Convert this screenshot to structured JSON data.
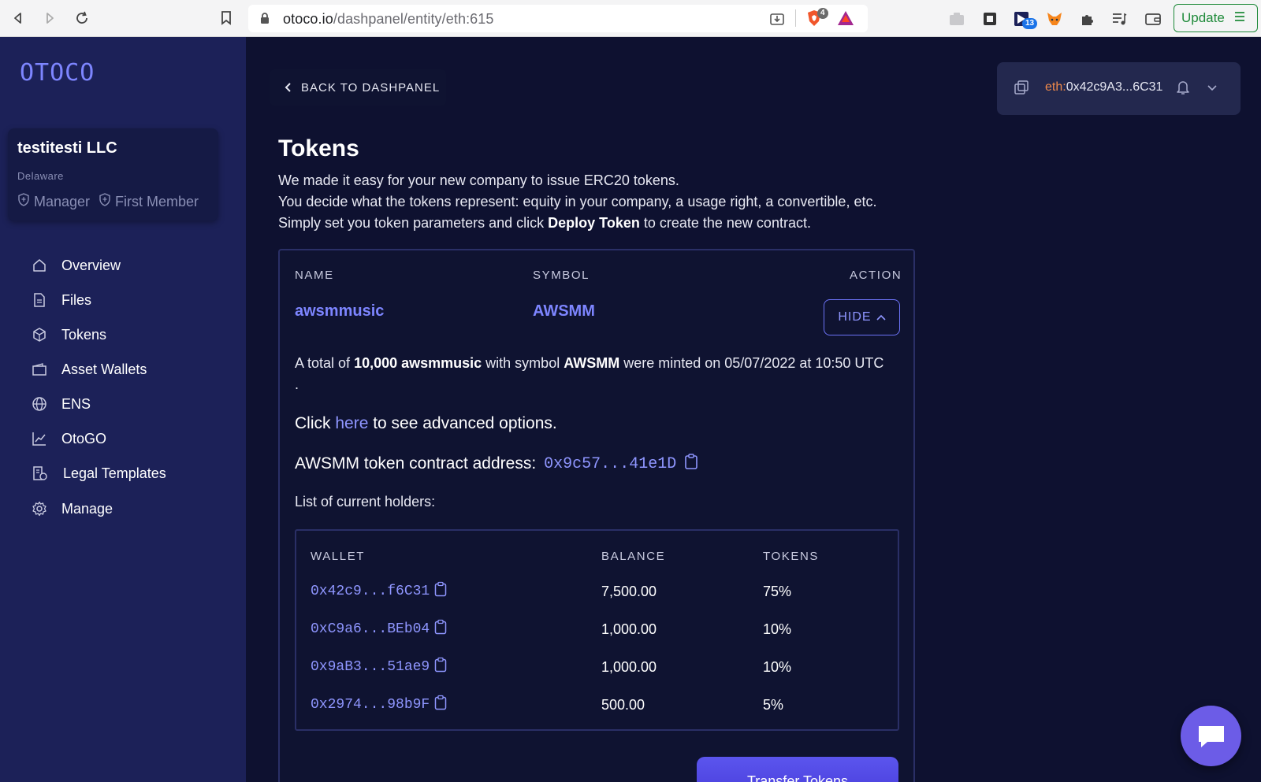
{
  "browser": {
    "url_host": "otoco.io",
    "url_path": "/dashpanel/entity/eth:615",
    "brave_badge": "4",
    "ext_badge": "13",
    "update_label": "Update"
  },
  "sidebar": {
    "logo": "OTOCO",
    "company": {
      "name": "testitesti LLC",
      "state": "Delaware",
      "roles": [
        "Manager",
        "First Member"
      ]
    },
    "items": [
      {
        "label": "Overview",
        "icon": "home-icon"
      },
      {
        "label": "Files",
        "icon": "file-icon"
      },
      {
        "label": "Tokens",
        "icon": "cube-icon"
      },
      {
        "label": "Asset Wallets",
        "icon": "wallet-icon"
      },
      {
        "label": "ENS",
        "icon": "globe-icon"
      },
      {
        "label": "OtoGO",
        "icon": "chart-icon"
      },
      {
        "label": "Legal Templates",
        "icon": "document-icon"
      },
      {
        "label": "Manage",
        "icon": "gear-icon"
      }
    ]
  },
  "header": {
    "back_label": "BACK TO DASHPANEL",
    "wallet_prefix": "eth:",
    "wallet_address": "0x42c9A3...6C31"
  },
  "main": {
    "title": "Tokens",
    "intro": {
      "line1": "We made it easy for your new company to issue ERC20 tokens.",
      "line2": "You decide what the tokens represent: equity in your company, a usage right, a convertible, etc.",
      "line3_before": "Simply set you token parameters and click ",
      "line3_bold": "Deploy Token",
      "line3_after": " to create the new contract."
    },
    "table_headers": {
      "name": "NAME",
      "symbol": "SYMBOL",
      "action": "ACTION"
    },
    "token": {
      "name": "awsmmusic",
      "symbol": "AWSMM",
      "hide_label": "HIDE"
    },
    "mint": {
      "prefix": "A total of ",
      "amount": "10,000 awsmmusic",
      "mid": " with symbol ",
      "symbol": "AWSMM",
      "suffix": " were minted on 05/07/2022 at 10:50 UTC",
      "trail": "."
    },
    "advanced": {
      "before": "Click ",
      "link": "here",
      "after": " to see advanced options."
    },
    "contract": {
      "label": "AWSMM token contract address:",
      "address": "0x9c57...41e1D"
    },
    "holders_label": "List of current holders:",
    "holders_headers": {
      "wallet": "WALLET",
      "balance": "BALANCE",
      "tokens": "TOKENS"
    },
    "holders": [
      {
        "wallet": "0x42c9...f6C31",
        "balance": "7,500.00",
        "tokens": "75%"
      },
      {
        "wallet": "0xC9a6...BEb04",
        "balance": "1,000.00",
        "tokens": "10%"
      },
      {
        "wallet": "0x9aB3...51ae9",
        "balance": "1,000.00",
        "tokens": "10%"
      },
      {
        "wallet": "0x2974...98b9F",
        "balance": "500.00",
        "tokens": "5%"
      }
    ],
    "transfer_label": "Transfer Tokens"
  },
  "colors": {
    "accent": "#7d85ff",
    "sidebar": "#1c2158",
    "background": "#0e1130",
    "wallet_prefix": "#f08a4b"
  }
}
